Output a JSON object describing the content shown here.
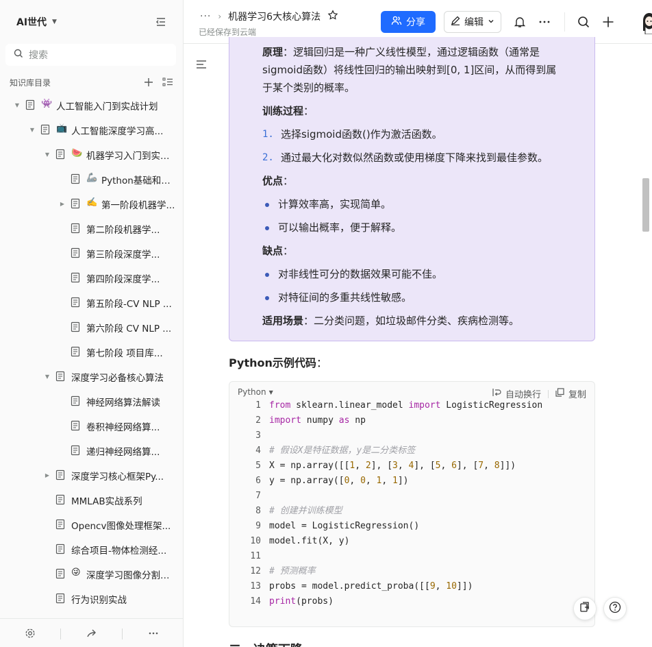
{
  "sidebar": {
    "space_name": "AI世代",
    "search_placeholder": "搜索",
    "catalog_title": "知识库目录",
    "items": [
      {
        "label": "人工智能入门到实战计划",
        "emoji": "👾",
        "level": 1,
        "arrow": "down"
      },
      {
        "label": "人工智能深度学习高...",
        "emoji": "📺",
        "level": 2,
        "arrow": "down"
      },
      {
        "label": "机器学习入门到实战...",
        "emoji": "🍉",
        "level": 3,
        "arrow": "down"
      },
      {
        "label": "Python基础和数...",
        "emoji": "🦾",
        "level": 4,
        "arrow": "none"
      },
      {
        "label": "第一阶段机器学...",
        "emoji": "✍️",
        "level": 4,
        "arrow": "right"
      },
      {
        "label": "第二阶段机器学...",
        "emoji": "",
        "level": 4,
        "arrow": "none"
      },
      {
        "label": "第三阶段深度学...",
        "emoji": "",
        "level": 4,
        "arrow": "none"
      },
      {
        "label": "第四阶段深度学...",
        "emoji": "",
        "level": 4,
        "arrow": "none"
      },
      {
        "label": "第五阶段-CV NLP ...",
        "emoji": "",
        "level": 4,
        "arrow": "none"
      },
      {
        "label": "第六阶段 CV NLP ...",
        "emoji": "",
        "level": 4,
        "arrow": "none"
      },
      {
        "label": "第七阶段 项目库...",
        "emoji": "",
        "level": 4,
        "arrow": "none"
      },
      {
        "label": "深度学习必备核心算法",
        "emoji": "",
        "level": 3,
        "arrow": "down"
      },
      {
        "label": "神经网络算法解读",
        "emoji": "",
        "level": 4,
        "arrow": "none"
      },
      {
        "label": "卷积神经网络算...",
        "emoji": "",
        "level": 4,
        "arrow": "none"
      },
      {
        "label": "递归神经网络算...",
        "emoji": "",
        "level": 4,
        "arrow": "none"
      },
      {
        "label": "深度学习核心框架Py...",
        "emoji": "",
        "level": 3,
        "arrow": "right"
      },
      {
        "label": "MMLAB实战系列",
        "emoji": "",
        "level": 3,
        "arrow": "none"
      },
      {
        "label": "Opencv图像处理框架...",
        "emoji": "",
        "level": 3,
        "arrow": "none"
      },
      {
        "label": "综合项目-物体检测经...",
        "emoji": "",
        "level": 3,
        "arrow": "none"
      },
      {
        "label": "深度学习图像分割实战",
        "emoji": "😜",
        "level": 3,
        "arrow": "none"
      },
      {
        "label": "行为识别实战",
        "emoji": "",
        "level": 3,
        "arrow": "none"
      }
    ]
  },
  "header": {
    "breadcrumb_more": "···",
    "doc_title": "机器学习6大核心算法",
    "saved_status": "已经保存到云端",
    "share_label": "分享",
    "edit_label": "编辑"
  },
  "doc": {
    "principle_label": "原理",
    "principle_line1": "：逻辑回归是一种广义线性模型，通过逻辑函数（通常是",
    "principle_line2": "sigmoid函数）将线性回归的输出映射到[0, 1]区间，从而得到属",
    "principle_line3": "于某个类别的概率。",
    "training_label": "训练过程",
    "colon": "：",
    "steps": [
      {
        "num": "1.",
        "text": "选择sigmoid函数()作为激活函数。"
      },
      {
        "num": "2.",
        "text": "通过最大化对数似然函数或使用梯度下降来找到最佳参数。"
      }
    ],
    "pros_label": "优点",
    "pros": [
      "计算效率高，实现简单。",
      "可以输出概率，便于解释。"
    ],
    "cons_label": "缺点",
    "cons": [
      "对非线性可分的数据效果可能不佳。",
      "对特征间的多重共线性敏感。"
    ],
    "scene_label": "适用场景",
    "scene_text": "：二分类问题，如垃圾邮件分类、疾病检测等。",
    "python_heading": "Python示例代码",
    "next_heading": "二、决策下降"
  },
  "code": {
    "language": "Python",
    "wrap_label": "自动换行",
    "copy_label": "复制",
    "lines": [
      "from sklearn.linear_model import LogisticRegression",
      "import numpy as np",
      "",
      "# 假设X是特征数据，y是二分类标签",
      "X = np.array([[1, 2], [3, 4], [5, 6], [7, 8]])",
      "y = np.array([0, 0, 1, 1])",
      "",
      "# 创建并训练模型",
      "model = LogisticRegression()",
      "model.fit(X, y)",
      "",
      "# 预测概率",
      "probs = model.predict_proba([[9, 10]])",
      "print(probs)"
    ]
  },
  "colors": {
    "accent": "#1f6bff",
    "callout_bg": "#ece6f9",
    "callout_border": "#c9b9ee"
  }
}
